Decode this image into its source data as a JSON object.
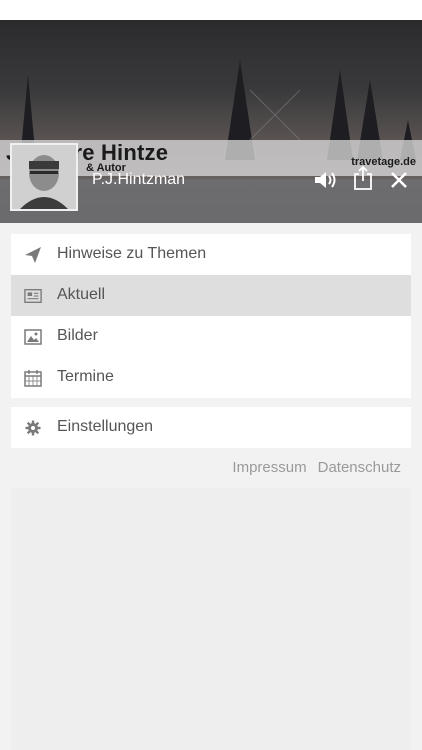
{
  "header": {
    "banner_title": "J. Pierre Hintze",
    "banner_subtitle": "& Autor",
    "banner_site": "travetage.de",
    "username": "P.J.Hintzman",
    "icons": [
      "volume-icon",
      "share-icon",
      "close-icon"
    ]
  },
  "menu": {
    "items": [
      {
        "label": "Hinweise zu Themen",
        "icon": "paper-plane-icon",
        "active": false
      },
      {
        "label": "Aktuell",
        "icon": "newspaper-icon",
        "active": true
      },
      {
        "label": "Bilder",
        "icon": "image-icon",
        "active": false
      },
      {
        "label": "Termine",
        "icon": "calendar-icon",
        "active": false
      }
    ]
  },
  "settings": {
    "label": "Einstellungen",
    "icon": "gear-icon"
  },
  "footer": {
    "impressum": "Impressum",
    "datenschutz": "Datenschutz"
  },
  "colors": {
    "userbar": "#6e6e70",
    "active_row": "#dedede",
    "menu_text": "#555555",
    "footer_link": "#9a9a9a"
  }
}
